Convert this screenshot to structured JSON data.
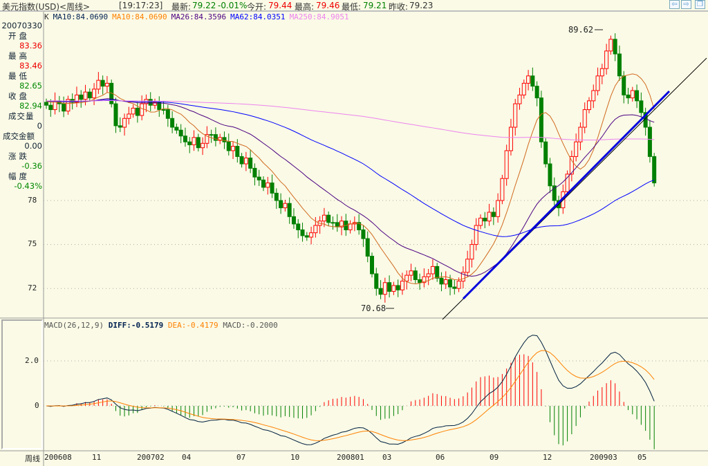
{
  "title": "美元指数(USD)<周线>",
  "quote": {
    "time": "[19:17:23]",
    "latest_label": "最新:",
    "latest": "79.22",
    "change": "-0.01%",
    "open_label": "今开:",
    "open": "79.44",
    "high_label": "最高:",
    "high": "79.46",
    "low_label": "最低:",
    "low": "79.21",
    "prev_label": "昨收:",
    "prev": "79.23"
  },
  "nav": {
    "back_icon": "⇦",
    "forward_icon": "⇨",
    "restore_icon": "❐"
  },
  "ma_legend": {
    "k": "K",
    "ma10a": "MA10:84.0690",
    "ma10b": "MA10:84.0690",
    "ma26": "MA26:84.3596",
    "ma62": "MA62:84.0351",
    "ma250": "MA250:84.9051"
  },
  "info": {
    "date": "20070330",
    "open_label": "开盘",
    "open": "83.36",
    "high_label": "最高",
    "high": "83.46",
    "low_label": "最低",
    "low": "82.65",
    "close_label": "收盘",
    "close": "82.94",
    "vol_label": "成交量",
    "vol": "0",
    "amount_label": "成交金额",
    "amount": "0.00",
    "chg_label": "涨跌",
    "chg": "-0.36",
    "pct_label": "幅度",
    "pct": "-0.43%"
  },
  "macd_legend": {
    "name": "MACD(26,12,9)",
    "diff": "DIFF:-0.5179",
    "dea": "DEA:-0.4179",
    "macd": "MACD:-0.2000"
  },
  "colors": {
    "up": "#ff0000",
    "down": "#008000",
    "ma10": "#d2691e",
    "ma26": "#4b0082",
    "ma62": "#0000ff",
    "ma250": "#ee82ee",
    "trend": "#0000dd",
    "diff": "#001f3f",
    "dea": "#ff8000"
  },
  "chart_data": {
    "type": "candlestick",
    "price_ticks": [
      "78",
      "75",
      "72"
    ],
    "macd_ticks": [
      "2.0",
      "0"
    ],
    "period_label": "周线",
    "date_ticks": [
      "200608",
      "11",
      "200702",
      "04",
      "07",
      "10",
      "200801",
      "03",
      "06",
      "09",
      "12",
      "200903",
      "05"
    ],
    "annotations": {
      "max": "89.62",
      "min": "70.68"
    },
    "weekly_close": [
      84.5,
      84.2,
      84.8,
      84.6,
      84.1,
      84.9,
      84.7,
      85.2,
      84.9,
      85.4,
      85.0,
      85.6,
      86.2,
      85.8,
      86.0,
      84.6,
      83.1,
      83.0,
      83.6,
      83.9,
      84.3,
      83.8,
      84.6,
      84.9,
      84.5,
      84.7,
      84.2,
      84.2,
      83.6,
      83.0,
      82.8,
      82.4,
      82.0,
      81.8,
      82.3,
      81.6,
      81.9,
      82.5,
      82.5,
      82.1,
      82.3,
      82.0,
      81.4,
      81.7,
      81.0,
      80.5,
      80.9,
      80.2,
      79.6,
      79.4,
      78.9,
      79.2,
      78.5,
      78.0,
      77.5,
      77.8,
      76.9,
      76.4,
      76.0,
      75.6,
      75.5,
      75.8,
      76.3,
      76.6,
      77.0,
      76.5,
      76.5,
      76.2,
      76.6,
      76.0,
      76.4,
      76.5,
      76.0,
      75.4,
      74.2,
      73.0,
      72.0,
      71.6,
      72.4,
      71.8,
      72.2,
      71.9,
      72.5,
      72.9,
      73.2,
      72.6,
      72.4,
      72.8,
      73.0,
      73.5,
      72.7,
      72.3,
      72.6,
      72.1,
      72.0,
      72.5,
      73.1,
      74.0,
      75.0,
      76.3,
      76.8,
      76.6,
      77.2,
      76.9,
      78.0,
      79.5,
      81.4,
      83.0,
      84.6,
      85.2,
      86.0,
      86.5,
      85.8,
      85.0,
      82.0,
      80.5,
      79.0,
      78.0,
      77.5,
      78.6,
      79.8,
      81.0,
      82.0,
      83.0,
      84.2,
      84.8,
      85.5,
      86.5,
      87.0,
      88.2,
      89.0,
      88.0,
      86.5,
      85.2,
      85.0,
      85.5,
      84.8,
      84.0,
      83.0,
      81.0,
      79.2
    ]
  }
}
